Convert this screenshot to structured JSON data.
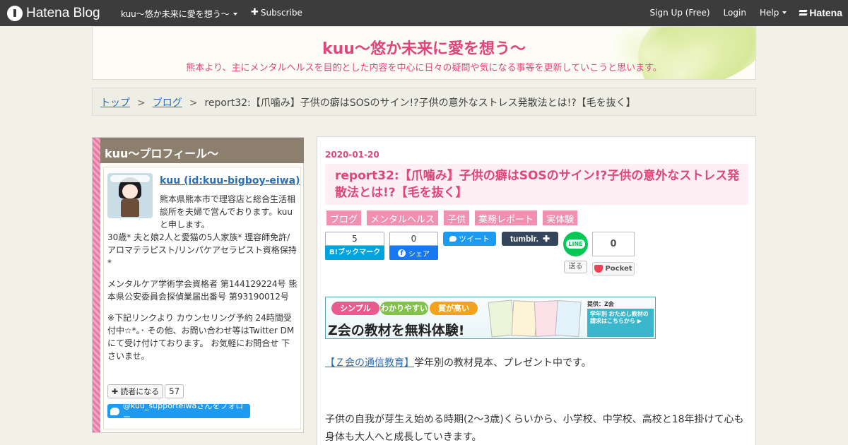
{
  "topbar": {
    "brand": "Hatena Blog",
    "blog_menu": "kuu～悠か未来に愛を想う～",
    "subscribe": "Subscribe",
    "signup": "Sign Up (Free)",
    "login": "Login",
    "help": "Help",
    "hatena": "Hatena"
  },
  "header": {
    "title": "kuu～悠か未来に愛を想う～",
    "description": "熊本より、主にメンタルヘルスを目的とした内容を中心に日々の疑問や気になる事等を更新していこうと思います。"
  },
  "breadcrumb": {
    "items": [
      "トップ",
      "ブログ"
    ],
    "separator": ">",
    "current": "report32:【爪噛み】子供の癖はSOSのサイン!?子供の意外なストレス発散法とは!?【毛を抜く】"
  },
  "profile": {
    "heading": "kuu～プロフィール～",
    "name": "kuu (id:kuu-bigboy-eiwa)",
    "intro": "熊本県熊本市で理容店と総合生活相談所を夫婦で営んでおります。kuuと申します。",
    "family": "30歳* 夫と娘2人と愛猫の5人家族* 理容師免許/アロマテラピスト/リンパケアセラピスト資格保持*",
    "licenses": "メンタルケア学術学会資格者 第144129224号 熊本県公安委員会探偵業届出番号 第93190012号",
    "notice": "※下記リンクより カウンセリング予約 24時間受付中☆*｡･ その他、お問い合わせ等はTwitter DMにて受け付けております。 お気軽にお問合せ 下さいませ。",
    "reader_button": "読者になる",
    "reader_count": "57",
    "twitter_follow": "@kuu_supporteiwaさんをフォロー"
  },
  "article": {
    "date": "2020-01-20",
    "title": "report32:【爪噛み】子供の癖はSOSのサイン!?子供の意外なストレス発散法とは!?【毛を抜く】",
    "categories": [
      "ブログ",
      "メンタルヘルス",
      "子供",
      "業務レポート",
      "実体験"
    ],
    "share": {
      "hatena_count": "5",
      "hatena_label": "B!ブックマーク",
      "facebook_count": "0",
      "facebook_label": "シェア",
      "tweet_label": "ツイート",
      "tumblr_label": "tumblr.",
      "line_label": "LINE",
      "line_send": "送る",
      "pocket_count": "0",
      "pocket_label": "Pocket"
    },
    "banner": {
      "pills": [
        "シンプル",
        "わかりやすい",
        "質が高い"
      ],
      "headline": "Z会の教材を無料体験!",
      "provider": "提供：Z会",
      "cta": "学年別 おためし教材の 請求はこちらから ▶"
    },
    "link_text": "【Ｚ会の通信教育】",
    "link_suffix": "学年別の教材見本、プレゼント中です。",
    "body_text": "子供の自我が芽生え始める時期(2～3歳)くらいから、小学校、中学校、高校と18年掛けて心も身体も大人へと成長していきます。"
  },
  "colors": {
    "accent": "#e0457b",
    "topbar": "#3c3c3c",
    "link": "#2a6fb5",
    "category": "#f28fb2"
  }
}
